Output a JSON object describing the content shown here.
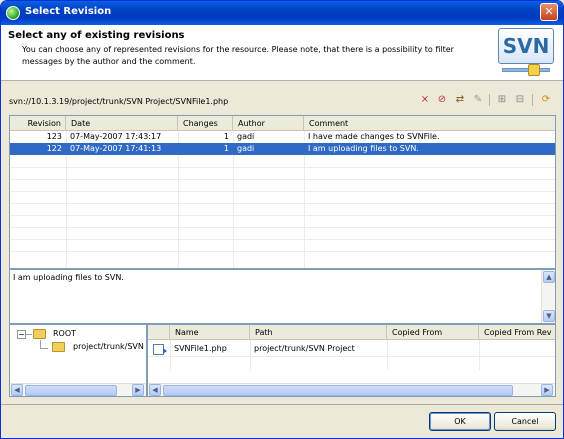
{
  "window": {
    "title": "Select Revision",
    "close_icon": "close-icon"
  },
  "header": {
    "title": "Select any of existing revisions",
    "description": "You can choose any of represented revisions for the resource. Please note, that there is a possibility to filter messages by the author and the comment.",
    "logo_text": "SVN"
  },
  "resource_path": "svn://10.1.3.19/project/trunk/SVN Project/SVNFile1.php",
  "toolbar": {
    "icons": [
      "filter-icon",
      "clear-filter-icon",
      "compare-icon",
      "edit-icon",
      "expand-icon",
      "collapse-icon",
      "refresh-icon"
    ]
  },
  "revisions": {
    "columns": [
      "Revision",
      "Date",
      "Changes",
      "Author",
      "Comment"
    ],
    "rows": [
      {
        "revision": "123",
        "date": "07-May-2007 17:43:17",
        "changes": "1",
        "author": "gadi",
        "comment": "I have made changes to SVNFile."
      },
      {
        "revision": "122",
        "date": "07-May-2007 17:41:13",
        "changes": "1",
        "author": "gadi",
        "comment": "I am uploading files to SVN."
      }
    ],
    "selected_index": 1
  },
  "comment_view": {
    "text": "I am uploading files to SVN."
  },
  "tree": {
    "root_label": "ROOT",
    "child_label": "project/trunk/SVN",
    "expander": "−"
  },
  "files": {
    "columns": [
      "Name",
      "Path",
      "Copied From",
      "Copied From Rev"
    ],
    "rows": [
      {
        "name": "SVNFile1.php",
        "path": "project/trunk/SVN Project",
        "copied_from": "",
        "copied_from_rev": ""
      }
    ]
  },
  "buttons": {
    "ok": "OK",
    "cancel": "Cancel"
  },
  "colors": {
    "titlebar": "#0a5fe6",
    "selection": "#316ac5",
    "window_bg": "#ece9d8"
  }
}
